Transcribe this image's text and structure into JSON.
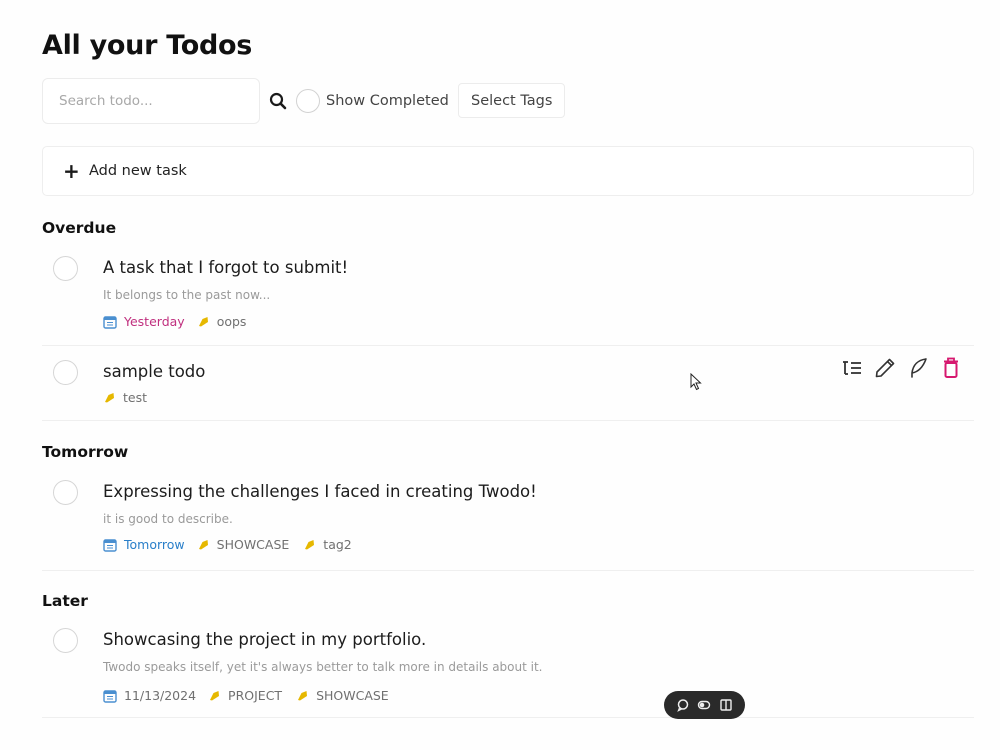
{
  "page": {
    "title": "All your Todos"
  },
  "toolbar": {
    "search_placeholder": "Search todo...",
    "show_completed_label": "Show Completed",
    "show_completed_checked": false,
    "select_tags_label": "Select Tags"
  },
  "add_task": {
    "label": "Add new task"
  },
  "sections": {
    "overdue": {
      "title": "Overdue",
      "tasks": [
        {
          "title": "A task that I forgot to submit!",
          "description": "It belongs to the past now...",
          "date": "Yesterday",
          "tags": [
            "oops"
          ]
        },
        {
          "title": "sample todo",
          "tags": [
            "test"
          ]
        }
      ]
    },
    "tomorrow": {
      "title": "Tomorrow",
      "tasks": [
        {
          "title": "Expressing the challenges I faced in creating Twodo!",
          "description": "it is good to describe.",
          "date": "Tomorrow",
          "tags": [
            "SHOWCASE",
            "tag2"
          ]
        }
      ]
    },
    "later": {
      "title": "Later",
      "tasks": [
        {
          "title": "Showcasing the project in my portfolio.",
          "description": "Twodo speaks itself, yet it's always better to talk more in details about it.",
          "date": "11/13/2024",
          "tags": [
            "PROJECT",
            "SHOWCASE"
          ]
        }
      ]
    }
  },
  "colors": {
    "overdue_date": "#c0307f",
    "tomorrow_date": "#2a7fc9",
    "later_date": "#707070",
    "tag_icon": "#e6b800",
    "delete_icon": "#d6186f",
    "calendar_icon": "#4a8fd0",
    "floating_bar": "#2a2a2a"
  },
  "icons": {
    "search": "search-icon",
    "add": "plus-icon",
    "calendar": "calendar-icon",
    "tag": "tag-icon",
    "subtasks": "subtasks-icon",
    "edit": "pencil-icon",
    "tags_edit": "feather-icon",
    "delete": "trash-icon"
  }
}
